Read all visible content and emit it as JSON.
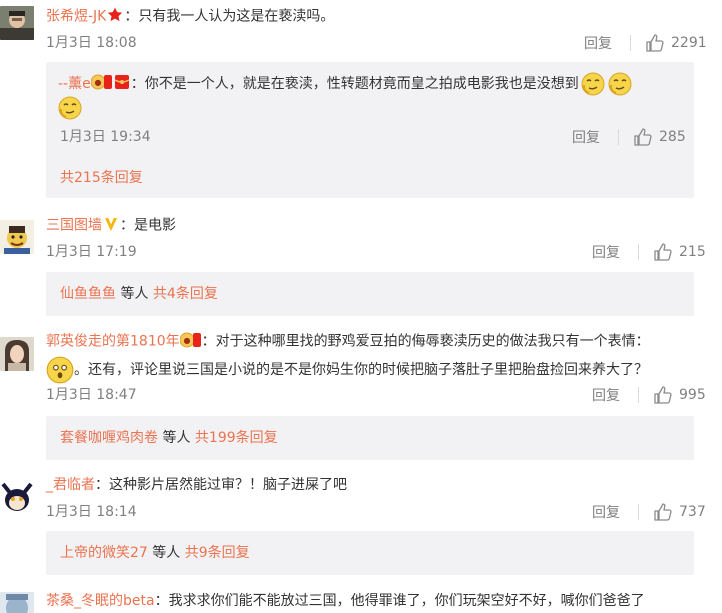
{
  "comments": [
    {
      "user": "张希煜-JK",
      "text": "：只有我一人认为这是在亵渎吗。",
      "time": "1月3日 18:08",
      "reply_label": "回复",
      "likes": "2291",
      "sub_reply": {
        "user": "--薰e",
        "text_line1": "：你不是一个人，就是在亵渎，性转题材竟而皇之拍成电影我也是没想到",
        "time": "1月3日 19:34",
        "reply_label": "回复",
        "likes": "285"
      },
      "total_replies": "共215条回复"
    },
    {
      "user": "三国图墙",
      "text": "：是电影",
      "time": "1月3日 17:19",
      "reply_label": "回复",
      "likes": "215",
      "summary": {
        "user": "仙鱼鱼鱼",
        "etc": "等人",
        "count": "共4条回复"
      }
    },
    {
      "user": "郭英俊走的第1810年",
      "text_line1": "：对于这种哪里找的野鸡爱豆拍的侮辱亵渎历史的做法我只有一个表情：",
      "text_line2": "。还有，评论里说三国是小说的是不是你妈生你的时候把脑子落肚子里把胎盘捡回来养大了？",
      "time": "1月3日 18:47",
      "reply_label": "回复",
      "likes": "995",
      "summary": {
        "user": "套餐咖喱鸡肉卷",
        "etc": "等人",
        "count": "共199条回复"
      }
    },
    {
      "user": "_君临者",
      "text": "：这种影片居然能过审？！脑子进屎了吧",
      "time": "1月3日 18:14",
      "reply_label": "回复",
      "likes": "737",
      "summary": {
        "user": "上帝的微笑27",
        "etc": "等人",
        "count": "共9条回复"
      }
    },
    {
      "user": "茶桑_冬眠的beta",
      "text": "：我求求你们能不能放过三国，他得罪谁了，你们玩架空好不好，喊你们爸爸了"
    }
  ],
  "colors": {
    "link": "#eb7350",
    "muted": "#808080",
    "reply_bg": "#f2f2f5"
  },
  "icons": [
    "thumb-up-icon",
    "vip-star-icon",
    "verified-v-icon",
    "fan-badge-icon",
    "red-packet-icon",
    "smirk-emoji-icon"
  ]
}
